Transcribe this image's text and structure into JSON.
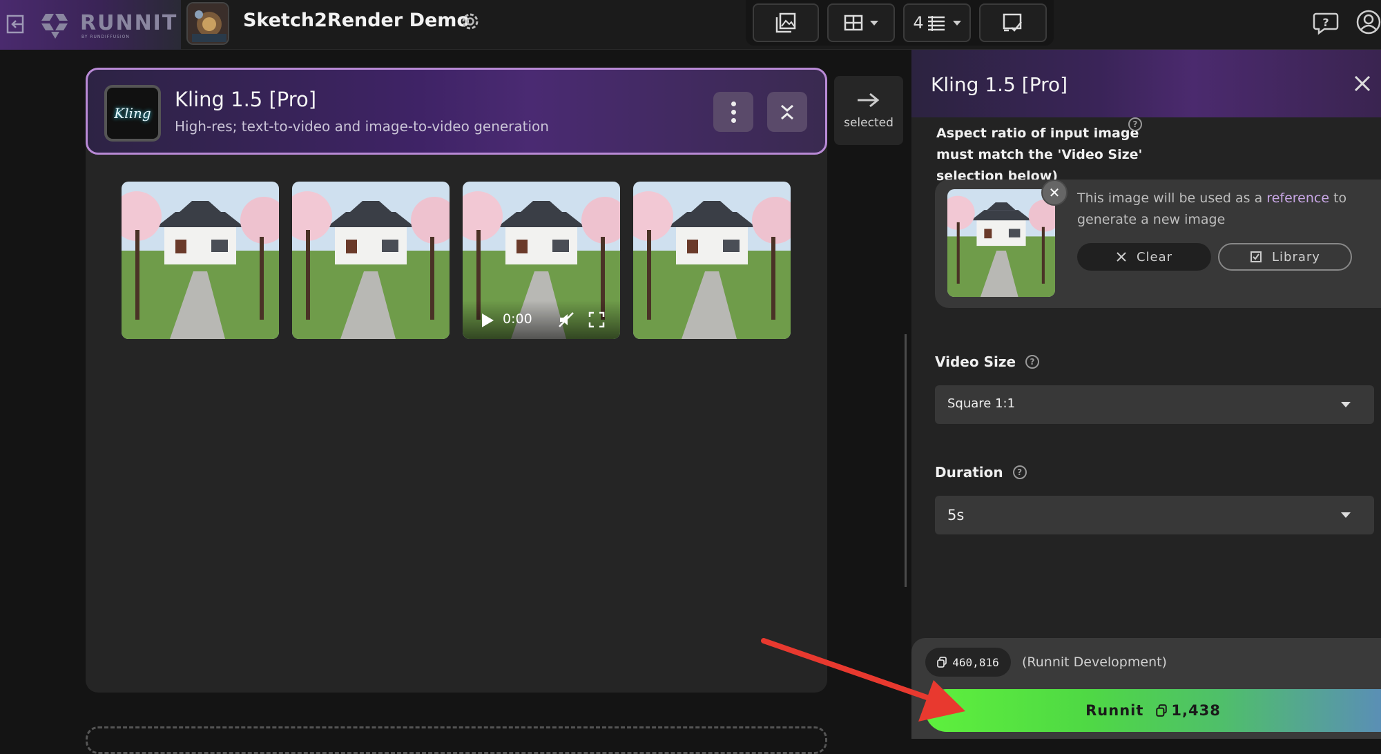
{
  "topbar": {
    "logo_text": "RUNNIT",
    "logo_sub": "BY RUNDIFFUSION",
    "app_title": "Sketch2Render Demo",
    "columns_value": "4"
  },
  "card": {
    "title": "Kling 1.5 [Pro]",
    "subtitle": "High-res; text-to-video and image-to-video generation",
    "video_time": "0:00"
  },
  "selected_tab": {
    "label": "selected"
  },
  "panel": {
    "title": "Kling 1.5 [Pro]",
    "aspect_note": "Aspect ratio of input image must match the 'Video Size' selection below)",
    "reference": {
      "text_before": "This image will be used as a ",
      "text_highlight": "reference",
      "text_after": " to generate a new image",
      "clear_label": "Clear",
      "library_label": "Library"
    },
    "video_size": {
      "label": "Video Size",
      "value": "Square 1:1"
    },
    "duration": {
      "label": "Duration",
      "value": "5s"
    }
  },
  "footer": {
    "credits": "460,816",
    "team": "(Runnit Development)",
    "run_label": "Runnit",
    "run_cost": "1,438"
  },
  "colors": {
    "accent_purple": "#b98ad6",
    "run_green": "#5ef03d",
    "annotation_red": "#e8392f"
  }
}
